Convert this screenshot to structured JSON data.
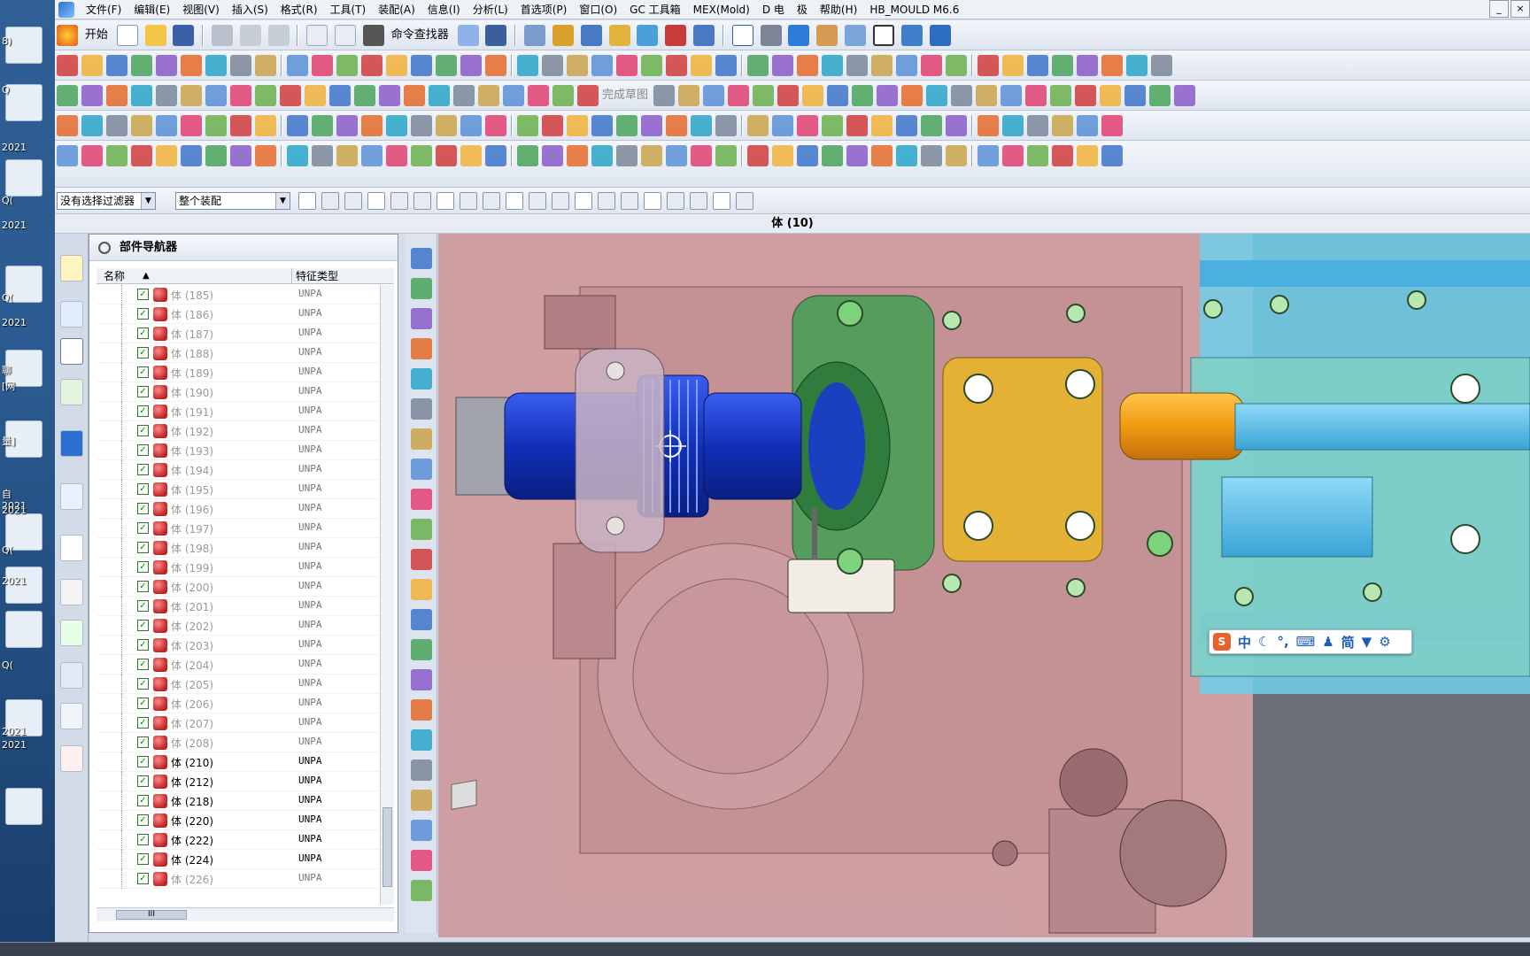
{
  "desktop": {
    "labels": [
      "8)",
      "Q",
      "2021",
      "Q(",
      "2021",
      "Q(",
      "2021",
      "聊",
      "[网",
      "量]",
      "自",
      "2021",
      "2021",
      "Q(",
      "2021",
      "Q(",
      "2021",
      "2021"
    ]
  },
  "menubar": {
    "items": [
      "文件(F)",
      "编辑(E)",
      "视图(V)",
      "插入(S)",
      "格式(R)",
      "工具(T)",
      "装配(A)",
      "信息(I)",
      "分析(L)",
      "首选项(P)",
      "窗口(O)",
      "GC 工具箱",
      "MEX(Mold)",
      "D 电",
      "极",
      "帮助(H)",
      "HB_MOULD M6.6"
    ],
    "win_min": "_",
    "win_close": "×"
  },
  "toolbar1": {
    "start_label": "开始",
    "cmd_finder_label": "命令查找器"
  },
  "toolbar3": {
    "finish_sketch_label": "完成草图"
  },
  "selection": {
    "filter_value": "没有选择过滤器",
    "scope_value": "整个装配"
  },
  "status": {
    "text": "体 (10)"
  },
  "navigator": {
    "title": "部件导航器",
    "col_name": "名称",
    "col_type": "特征类型",
    "rows": [
      {
        "name": "体 (185)",
        "type": "UNPA",
        "active": false
      },
      {
        "name": "体 (186)",
        "type": "UNPA",
        "active": false
      },
      {
        "name": "体 (187)",
        "type": "UNPA",
        "active": false
      },
      {
        "name": "体 (188)",
        "type": "UNPA",
        "active": false
      },
      {
        "name": "体 (189)",
        "type": "UNPA",
        "active": false
      },
      {
        "name": "体 (190)",
        "type": "UNPA",
        "active": false
      },
      {
        "name": "体 (191)",
        "type": "UNPA",
        "active": false
      },
      {
        "name": "体 (192)",
        "type": "UNPA",
        "active": false
      },
      {
        "name": "体 (193)",
        "type": "UNPA",
        "active": false
      },
      {
        "name": "体 (194)",
        "type": "UNPA",
        "active": false
      },
      {
        "name": "体 (195)",
        "type": "UNPA",
        "active": false
      },
      {
        "name": "体 (196)",
        "type": "UNPA",
        "active": false
      },
      {
        "name": "体 (197)",
        "type": "UNPA",
        "active": false
      },
      {
        "name": "体 (198)",
        "type": "UNPA",
        "active": false
      },
      {
        "name": "体 (199)",
        "type": "UNPA",
        "active": false
      },
      {
        "name": "体 (200)",
        "type": "UNPA",
        "active": false
      },
      {
        "name": "体 (201)",
        "type": "UNPA",
        "active": false
      },
      {
        "name": "体 (202)",
        "type": "UNPA",
        "active": false
      },
      {
        "name": "体 (203)",
        "type": "UNPA",
        "active": false
      },
      {
        "name": "体 (204)",
        "type": "UNPA",
        "active": false
      },
      {
        "name": "体 (205)",
        "type": "UNPA",
        "active": false
      },
      {
        "name": "体 (206)",
        "type": "UNPA",
        "active": false
      },
      {
        "name": "体 (207)",
        "type": "UNPA",
        "active": false
      },
      {
        "name": "体 (208)",
        "type": "UNPA",
        "active": false
      },
      {
        "name": "体 (210)",
        "type": "UNPA",
        "active": true
      },
      {
        "name": "体 (212)",
        "type": "UNPA",
        "active": true
      },
      {
        "name": "体 (218)",
        "type": "UNPA",
        "active": true
      },
      {
        "name": "体 (220)",
        "type": "UNPA",
        "active": true
      },
      {
        "name": "体 (222)",
        "type": "UNPA",
        "active": true
      },
      {
        "name": "体 (224)",
        "type": "UNPA",
        "active": true
      },
      {
        "name": "体 (226)",
        "type": "UNPA",
        "active": false
      }
    ]
  },
  "ime": {
    "logo": "S",
    "lang": "中",
    "simp": "简"
  },
  "colors": {
    "accent": "#1b5db7",
    "mold_pink": "#d9a3a6",
    "plate_cyan": "#4fb8e0",
    "gear_blue": "#1f3fcf",
    "green_part": "#3f9a50",
    "yellow_part": "#f1b23a"
  }
}
